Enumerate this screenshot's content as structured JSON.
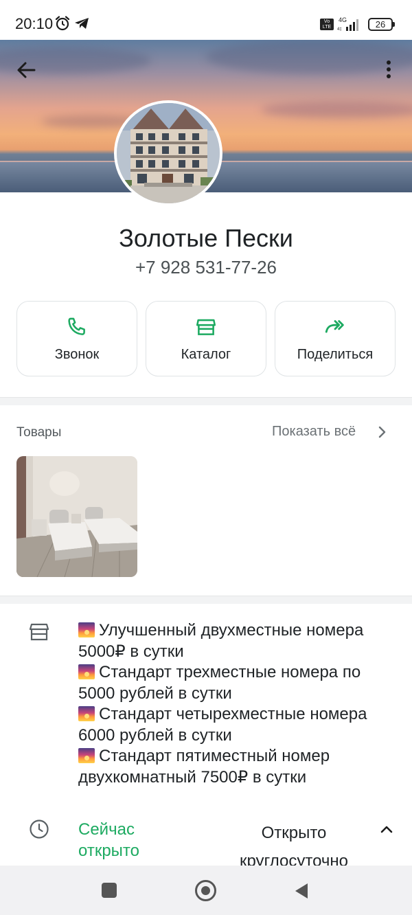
{
  "status_bar": {
    "time": "20:10",
    "network": "4G",
    "battery": "26"
  },
  "profile": {
    "name": "Золотые Пески",
    "phone": "+7 928 531-77-26"
  },
  "actions": [
    {
      "label": "Звонок",
      "icon": "phone-icon"
    },
    {
      "label": "Каталог",
      "icon": "storefront-icon"
    },
    {
      "label": "Поделиться",
      "icon": "share-forward-icon"
    }
  ],
  "goods": {
    "title": "Товары",
    "show_all": "Показать всё"
  },
  "description": {
    "lines": [
      "Улучшенный двухместные номера",
      "5000₽ в сутки",
      "Стандарт трехместные номера по",
      "5000 рублей в сутки",
      "Стандарт четырехместные номера",
      "6000 рублей в сутки",
      "Стандарт пятиместный номер",
      "двухкомнатный 7500₽ в сутки"
    ]
  },
  "hours": {
    "status_line1": "Сейчас",
    "status_line2": "открыто",
    "value_line1": "Открыто",
    "value_line2": "круглосуточно"
  },
  "colors": {
    "accent_green": "#1daa61",
    "text_primary": "#1f2326",
    "text_secondary": "#53595d"
  }
}
